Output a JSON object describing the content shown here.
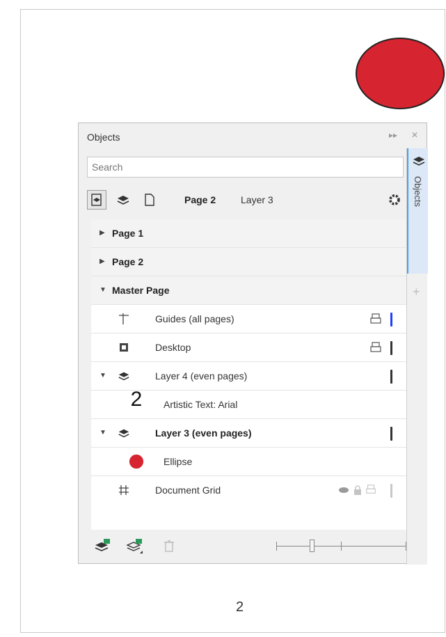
{
  "canvas": {
    "page_number": "2",
    "accent_red": "#d62430"
  },
  "panel": {
    "title": "Objects",
    "search_placeholder": "Search",
    "current_page": "Page 2",
    "current_layer": "Layer 3",
    "side_tab_label": "Objects",
    "accent_blue": "#1e3fff"
  },
  "tree": [
    {
      "label": "Page 1",
      "type": "page",
      "expanded": false
    },
    {
      "label": "Page 2",
      "type": "page",
      "expanded": false
    },
    {
      "label": "Master Page",
      "type": "page",
      "expanded": true
    },
    {
      "label": "Guides (all pages)",
      "type": "guides-layer",
      "icon": "guides-icon"
    },
    {
      "label": "Desktop",
      "type": "desktop-layer",
      "icon": "desktop-icon"
    },
    {
      "label": "Layer 4 (even pages)",
      "type": "layer",
      "icon": "layer-icon"
    },
    {
      "label": "Artistic Text: Arial",
      "type": "object",
      "icon_text": "2"
    },
    {
      "label": "Layer 3 (even pages)",
      "type": "layer",
      "icon": "layer-icon",
      "active": true
    },
    {
      "label": "Ellipse",
      "type": "object",
      "icon": "ellipse-icon"
    },
    {
      "label": "Document Grid",
      "type": "grid-layer",
      "icon": "grid-icon"
    }
  ]
}
